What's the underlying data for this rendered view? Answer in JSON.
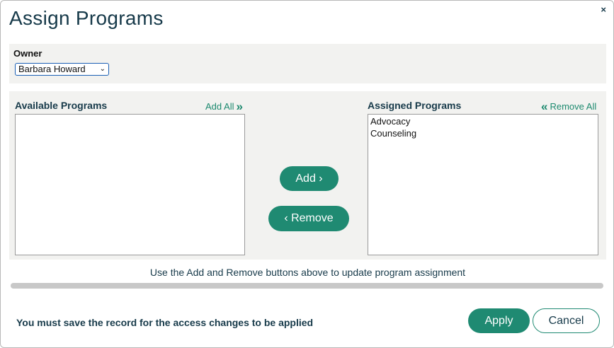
{
  "dialog": {
    "title": "Assign Programs",
    "close_glyph": "×"
  },
  "owner": {
    "label": "Owner",
    "selected": "Barbara Howard",
    "chevron": "⌄"
  },
  "available": {
    "label": "Available Programs",
    "add_all_label": "Add All",
    "add_all_icon": "»",
    "items": []
  },
  "assigned": {
    "label": "Assigned Programs",
    "remove_all_label": "Remove All",
    "remove_all_icon": "«",
    "items": [
      "Advocacy",
      "Counseling"
    ]
  },
  "actions": {
    "add_label": "Add ›",
    "remove_label": "‹ Remove"
  },
  "hint": "Use the Add and Remove buttons above to update program assignment",
  "footer": {
    "note": "You must save the record for the access changes to be applied",
    "apply_label": "Apply",
    "cancel_label": "Cancel"
  },
  "colors": {
    "accent": "#1f8a72",
    "title": "#173a4a",
    "panel_bg": "#f2f2f0"
  }
}
